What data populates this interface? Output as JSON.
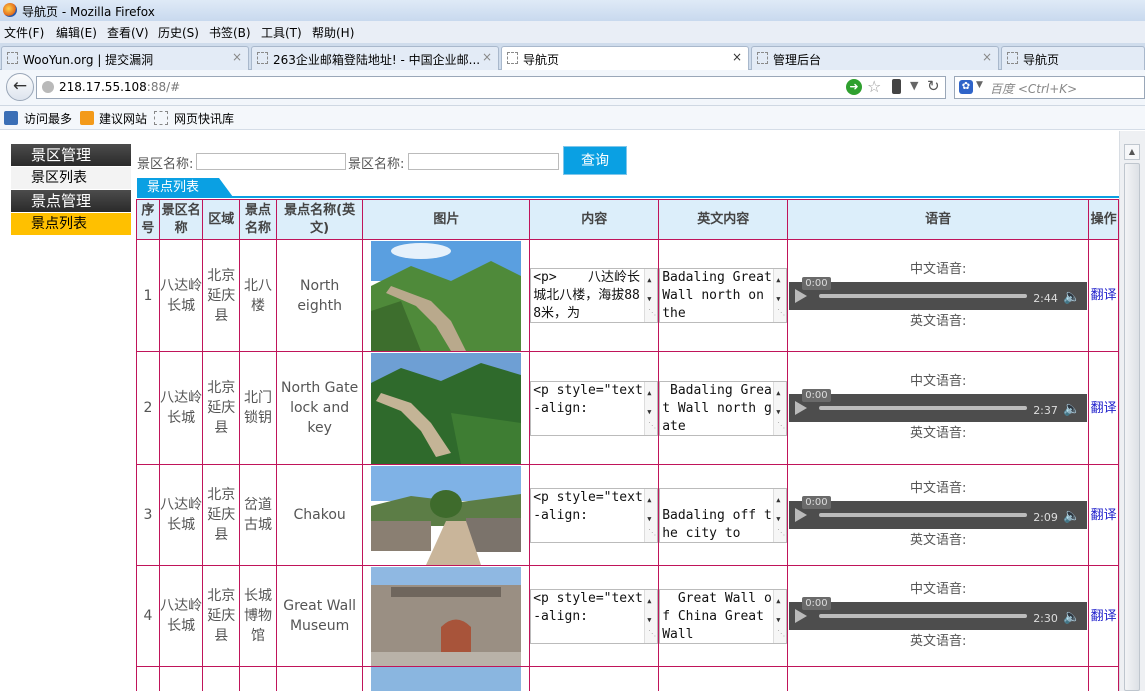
{
  "window": {
    "title": "导航页 - Mozilla Firefox"
  },
  "menu": [
    "文件(F)",
    "编辑(E)",
    "查看(V)",
    "历史(S)",
    "书签(B)",
    "工具(T)",
    "帮助(H)"
  ],
  "tabs": [
    {
      "label": "WooYun.org | 提交漏洞",
      "close": "×"
    },
    {
      "label": "263企业邮箱登陆地址! - 中国企业邮...",
      "close": "×"
    },
    {
      "label": "导航页",
      "close": "×"
    },
    {
      "label": "管理后台",
      "close": "×"
    },
    {
      "label": "导航页",
      "close": ""
    }
  ],
  "address": {
    "host": "218.17.55.108",
    "rest": ":88/#"
  },
  "search": {
    "placeholder": "百度 <Ctrl+K>"
  },
  "bookmarks": [
    "访问最多",
    "建议网站",
    "网页快讯库"
  ],
  "sidebar": {
    "groups": [
      {
        "title": "景区管理",
        "items": [
          "景区列表"
        ]
      },
      {
        "title": "景点管理",
        "items": [
          "景点列表"
        ]
      }
    ]
  },
  "filters": {
    "label1": "景区名称:",
    "label2": "景区名称:",
    "button": "查询"
  },
  "list_tab": "景点列表",
  "table": {
    "headers": [
      "序号",
      "景区名称",
      "区域",
      "景点名称",
      "景点名称(英文)",
      "图片",
      "内容",
      "英文内容",
      "语音",
      "操作"
    ],
    "audio_cn_label": "中文语音:",
    "audio_en_label": "英文语音:",
    "player_time": "0:00",
    "rows": [
      {
        "no": "1",
        "scenic": "八达岭长城",
        "area": "北京延庆县",
        "name": "北八楼",
        "name_en": "North eighth",
        "content": "<p>    八达岭长城北八楼，海拔888米，为",
        "content_en": "Badaling Great Wall north on the",
        "duration": "2:44",
        "op": "翻译"
      },
      {
        "no": "2",
        "scenic": "八达岭长城",
        "area": "北京延庆县",
        "name": "北门锁钥",
        "name_en": "North Gate lock and key",
        "content": "<p style=\"text-align:",
        "content_en": " Badaling Great Wall north gate",
        "duration": "2:37",
        "op": "翻译"
      },
      {
        "no": "3",
        "scenic": "八达岭长城",
        "area": "北京延庆县",
        "name": "岔道古城",
        "name_en": "Chakou",
        "content": "<p style=\"text-align:",
        "content_en": "\nBadaling off the city to",
        "duration": "2:09",
        "op": "翻译"
      },
      {
        "no": "4",
        "scenic": "八达岭长城",
        "area": "北京延庆县",
        "name": "长城博物馆",
        "name_en": "Great Wall Museum",
        "content": "<p style=\"text-align:",
        "content_en": "  Great Wall of China Great Wall",
        "duration": "2:30",
        "op": "翻译"
      }
    ]
  },
  "colors": {
    "accent": "#0aa0e3",
    "sidebar_active": "#ffc000",
    "grid_border": "#c0145a",
    "header_bg": "#dceefa"
  }
}
